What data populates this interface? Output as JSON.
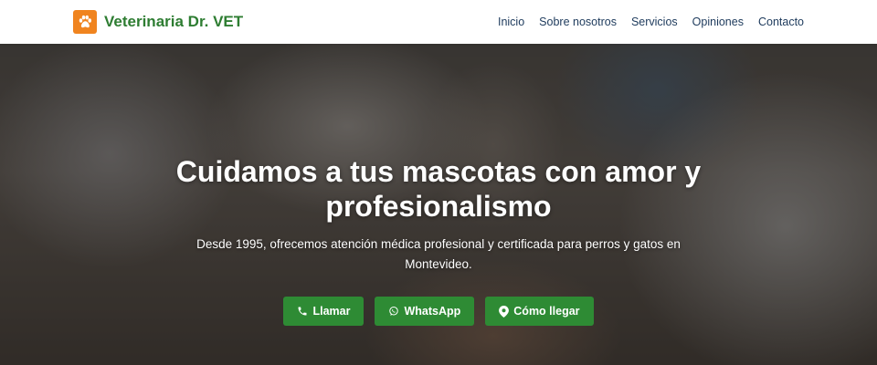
{
  "header": {
    "brand_name": "Veterinaria Dr. VET",
    "logo_icon": "paw-icon",
    "brand_color": "#f0841f",
    "nav": [
      {
        "label": "Inicio"
      },
      {
        "label": "Sobre nosotros"
      },
      {
        "label": "Servicios"
      },
      {
        "label": "Opiniones"
      },
      {
        "label": "Contacto"
      }
    ]
  },
  "hero": {
    "background": "person holding a tabby cat",
    "title": "Cuidamos a tus mascotas con amor y profesionalismo",
    "subtitle": "Desde 1995, ofrecemos atención médica profesional y certificada para perros y gatos en Montevideo.",
    "button_color": "#2e8b34",
    "buttons": [
      {
        "label": "Llamar",
        "icon": "phone-icon"
      },
      {
        "label": "WhatsApp",
        "icon": "whatsapp-icon"
      },
      {
        "label": "Cómo llegar",
        "icon": "map-pin-icon"
      }
    ]
  }
}
